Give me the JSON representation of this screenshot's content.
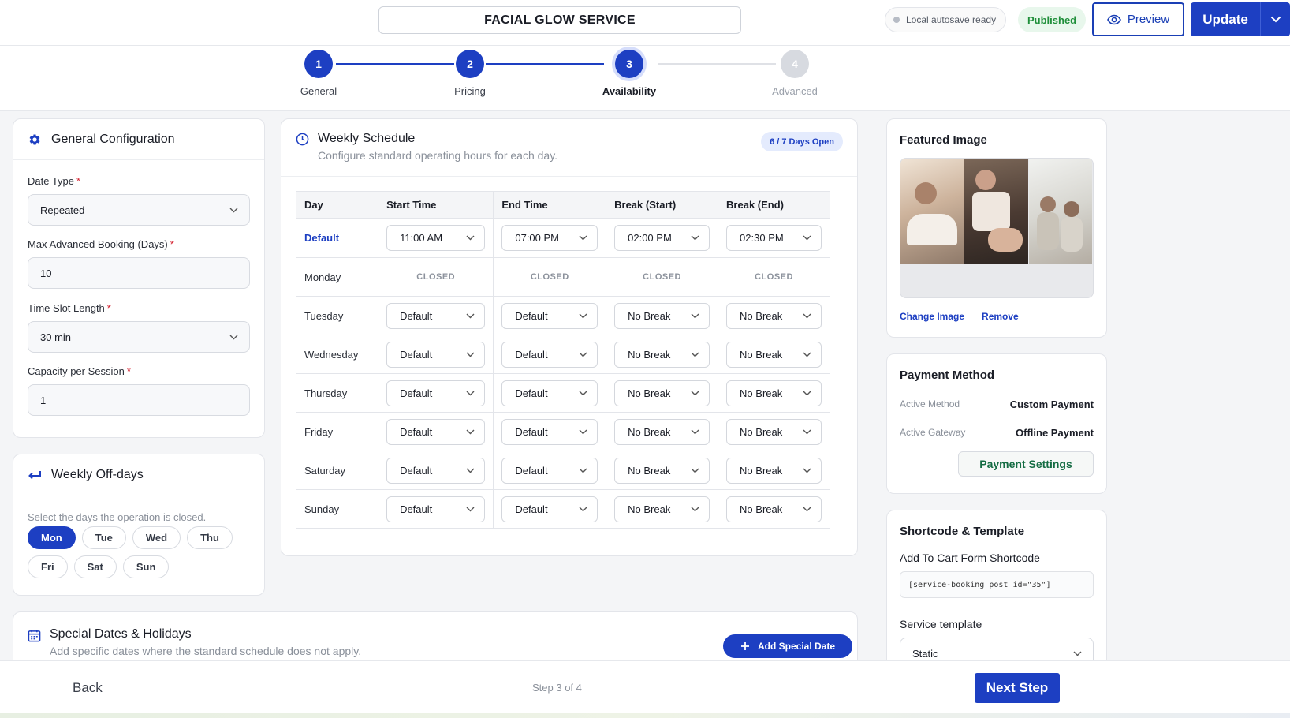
{
  "header": {
    "service_title": "FACIAL GLOW SERVICE",
    "autosave": "Local autosave ready",
    "status": "Published",
    "preview_label": "Preview",
    "update_label": "Update"
  },
  "stepper": {
    "steps": [
      {
        "num": "1",
        "label": "General"
      },
      {
        "num": "2",
        "label": "Pricing"
      },
      {
        "num": "3",
        "label": "Availability"
      },
      {
        "num": "4",
        "label": "Advanced"
      }
    ]
  },
  "general_config": {
    "title": "General Configuration",
    "date_type_label": "Date Type",
    "date_type_value": "Repeated",
    "max_booking_label": "Max Advanced Booking (Days)",
    "max_booking_value": "10",
    "slot_length_label": "Time Slot Length",
    "slot_length_value": "30 min",
    "capacity_label": "Capacity per Session",
    "capacity_value": "1",
    "required_mark": "*"
  },
  "off_days": {
    "title": "Weekly Off-days",
    "hint": "Select the days the operation is closed.",
    "days": [
      "Mon",
      "Tue",
      "Wed",
      "Thu",
      "Fri",
      "Sat",
      "Sun"
    ]
  },
  "schedule": {
    "title": "Weekly Schedule",
    "subtitle": "Configure standard operating hours for each day.",
    "badge": "6 / 7 Days Open",
    "headers": [
      "Day",
      "Start Time",
      "End Time",
      "Break (Start)",
      "Break (End)"
    ],
    "rows": [
      {
        "day": "Default",
        "cells": [
          "11:00 AM",
          "07:00 PM",
          "02:00 PM",
          "02:30 PM"
        ]
      },
      {
        "day": "Monday",
        "cells": [
          "CLOSED",
          "CLOSED",
          "CLOSED",
          "CLOSED"
        ]
      },
      {
        "day": "Tuesday",
        "cells": [
          "Default",
          "Default",
          "No Break",
          "No Break"
        ]
      },
      {
        "day": "Wednesday",
        "cells": [
          "Default",
          "Default",
          "No Break",
          "No Break"
        ]
      },
      {
        "day": "Thursday",
        "cells": [
          "Default",
          "Default",
          "No Break",
          "No Break"
        ]
      },
      {
        "day": "Friday",
        "cells": [
          "Default",
          "Default",
          "No Break",
          "No Break"
        ]
      },
      {
        "day": "Saturday",
        "cells": [
          "Default",
          "Default",
          "No Break",
          "No Break"
        ]
      },
      {
        "day": "Sunday",
        "cells": [
          "Default",
          "Default",
          "No Break",
          "No Break"
        ]
      }
    ]
  },
  "special_dates": {
    "title": "Special Dates & Holidays",
    "subtitle": "Add specific dates where the standard schedule does not apply.",
    "add_label": "Add Special Date"
  },
  "featured": {
    "title": "Featured Image",
    "change_label": "Change Image",
    "remove_label": "Remove"
  },
  "payment": {
    "title": "Payment Method",
    "method_key": "Active Method",
    "method_value": "Custom Payment",
    "gateway_key": "Active Gateway",
    "gateway_value": "Offline Payment",
    "settings_label": "Payment Settings"
  },
  "shortcode": {
    "title": "Shortcode & Template",
    "cart_label": "Add To Cart Form Shortcode",
    "code": "[service-booking post_id=\"35\"]",
    "template_label": "Service template",
    "template_value": "Static"
  },
  "footer": {
    "back": "Back",
    "step_text": "Step 3 of 4",
    "next": "Next Step"
  },
  "colors": {
    "primary": "#1d3fc2",
    "success": "#1f8f3a",
    "required": "#d4202f"
  }
}
